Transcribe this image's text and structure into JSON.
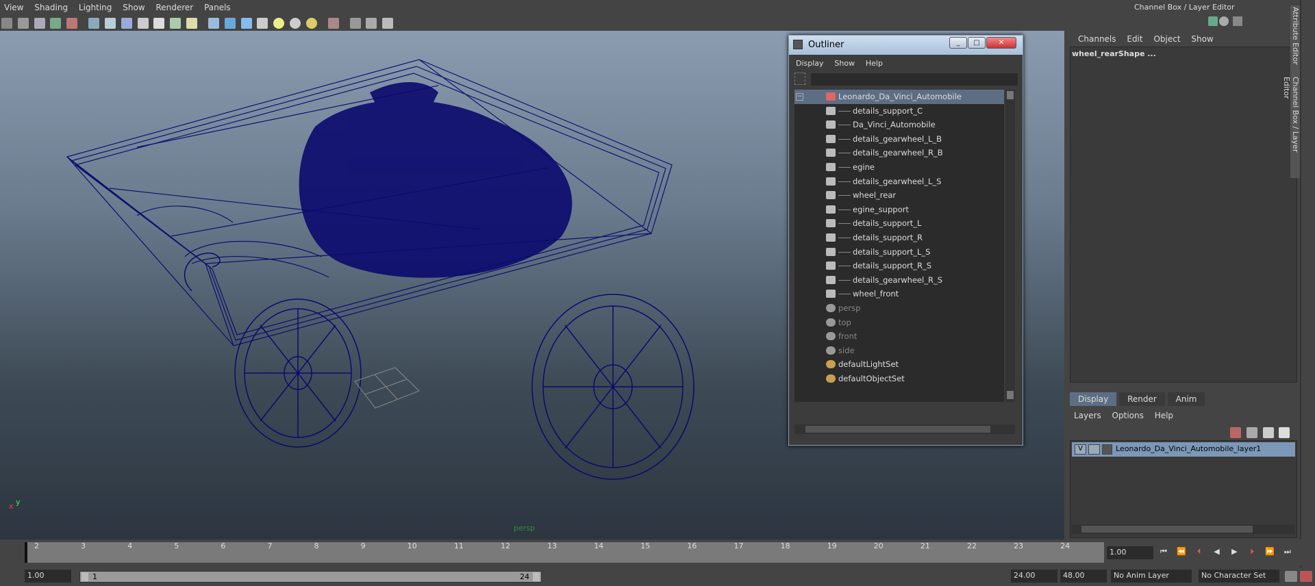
{
  "menubar": {
    "items": [
      "View",
      "Shading",
      "Lighting",
      "Show",
      "Renderer",
      "Panels"
    ]
  },
  "viewport": {
    "camera_label": "persp",
    "axis_x": "x",
    "axis_y": "y",
    "wire_color": "#0a0a6e"
  },
  "outliner": {
    "title": "Outliner",
    "menu": [
      "Display",
      "Show",
      "Help"
    ],
    "items": [
      {
        "label": "Leonardo_Da_Vinci_Automobile",
        "type": "group",
        "level": 0,
        "dim": false,
        "selected": true
      },
      {
        "label": "details_support_C",
        "type": "mesh",
        "level": 1,
        "dim": false
      },
      {
        "label": "Da_Vinci_Automobile",
        "type": "mesh",
        "level": 1,
        "dim": false
      },
      {
        "label": "details_gearwheel_L_B",
        "type": "mesh",
        "level": 1,
        "dim": false
      },
      {
        "label": "details_gearwheel_R_B",
        "type": "mesh",
        "level": 1,
        "dim": false
      },
      {
        "label": "egine",
        "type": "mesh",
        "level": 1,
        "dim": false
      },
      {
        "label": "details_gearwheel_L_S",
        "type": "mesh",
        "level": 1,
        "dim": false
      },
      {
        "label": "wheel_rear",
        "type": "mesh",
        "level": 1,
        "dim": false
      },
      {
        "label": "egine_support",
        "type": "mesh",
        "level": 1,
        "dim": false
      },
      {
        "label": "details_support_L",
        "type": "mesh",
        "level": 1,
        "dim": false
      },
      {
        "label": "details_support_R",
        "type": "mesh",
        "level": 1,
        "dim": false
      },
      {
        "label": "details_support_L_S",
        "type": "mesh",
        "level": 1,
        "dim": false
      },
      {
        "label": "details_support_R_S",
        "type": "mesh",
        "level": 1,
        "dim": false
      },
      {
        "label": "details_gearwheel_R_S",
        "type": "mesh",
        "level": 1,
        "dim": false
      },
      {
        "label": "wheel_front",
        "type": "mesh",
        "level": 1,
        "dim": false
      },
      {
        "label": "persp",
        "type": "camera",
        "level": 0,
        "dim": true
      },
      {
        "label": "top",
        "type": "camera",
        "level": 0,
        "dim": true
      },
      {
        "label": "front",
        "type": "camera",
        "level": 0,
        "dim": true
      },
      {
        "label": "side",
        "type": "camera",
        "level": 0,
        "dim": true
      },
      {
        "label": "defaultLightSet",
        "type": "set",
        "level": 0,
        "dim": false
      },
      {
        "label": "defaultObjectSet",
        "type": "set",
        "level": 0,
        "dim": false
      }
    ]
  },
  "channelbox": {
    "title": "Channel Box / Layer Editor",
    "menu": [
      "Channels",
      "Edit",
      "Object",
      "Show"
    ],
    "object_name": "wheel_rearShape ...",
    "side_tab_attr": "Attribute Editor",
    "side_tab_cb": "Channel Box / Layer Editor"
  },
  "layers": {
    "tabs": [
      "Display",
      "Render",
      "Anim"
    ],
    "menu": [
      "Layers",
      "Options",
      "Help"
    ],
    "rows": [
      {
        "visible": "V",
        "name": "Leonardo_Da_Vinci_Automobile_layer1"
      }
    ]
  },
  "timeline": {
    "ticks": [
      "2",
      "3",
      "4",
      "5",
      "6",
      "7",
      "8",
      "9",
      "10",
      "11",
      "12",
      "13",
      "14",
      "15",
      "16",
      "17",
      "18",
      "19",
      "20",
      "21",
      "22",
      "23",
      "24"
    ],
    "current_frame": "1.00"
  },
  "range": {
    "start": "1.00",
    "slider_start": "1",
    "slider_end": "24",
    "end": "24.00",
    "total_end": "48.00",
    "anim_layer": "No Anim Layer",
    "character_set": "No Character Set"
  }
}
